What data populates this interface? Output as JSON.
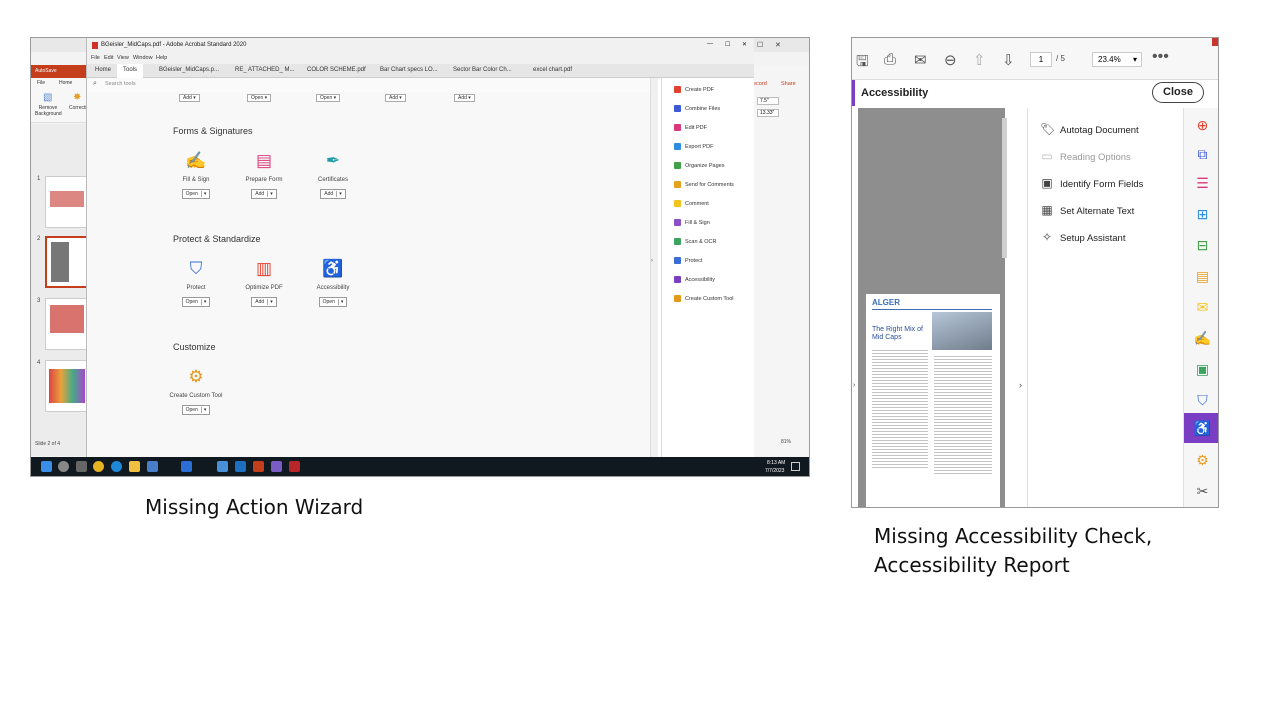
{
  "captions": {
    "left": "Missing Action Wizard",
    "right_line1": "Missing Accessibility Check,",
    "right_line2": "Accessibility Report"
  },
  "left_screenshot": {
    "acrobat": {
      "window_title": "BGeisler_MidCaps.pdf - Adobe Acrobat Standard 2020",
      "menu": [
        "File",
        "Edit",
        "View",
        "Window",
        "Help"
      ],
      "tabs": [
        "Home",
        "Tools",
        "BGeisler_MidCaps.p...",
        "RE_ ATTACHED_ M...",
        "COLOR SCHEME.pdf",
        "Bar Chart specs LO...",
        "Sector Bar Color Ch...",
        "excel chart.pdf"
      ],
      "active_tab": "Tools",
      "search_placeholder": "Search tools",
      "stub_buttons": [
        "Add",
        "Open",
        "Open",
        "Add",
        "Add"
      ],
      "sections": {
        "forms": {
          "title": "Forms & Signatures",
          "tools": [
            {
              "label": "Fill & Sign",
              "button": "Open",
              "icon": "fill-sign-icon"
            },
            {
              "label": "Prepare Form",
              "button": "Add",
              "icon": "prepare-form-icon"
            },
            {
              "label": "Certificates",
              "button": "Add",
              "icon": "certificates-icon"
            }
          ]
        },
        "protect": {
          "title": "Protect & Standardize",
          "tools": [
            {
              "label": "Protect",
              "button": "Open",
              "icon": "protect-icon"
            },
            {
              "label": "Optimize PDF",
              "button": "Add",
              "icon": "optimize-pdf-icon"
            },
            {
              "label": "Accessibility",
              "button": "Open",
              "icon": "accessibility-icon"
            }
          ]
        },
        "customize": {
          "title": "Customize",
          "tools": [
            {
              "label": "Create Custom Tool",
              "button": "Open",
              "icon": "custom-tool-icon"
            }
          ]
        }
      },
      "right_pane": [
        {
          "label": "Create PDF",
          "color": "#e2412f"
        },
        {
          "label": "Combine Files",
          "color": "#3d5bd9"
        },
        {
          "label": "Edit PDF",
          "color": "#d9397a"
        },
        {
          "label": "Export PDF",
          "color": "#2d8ee0"
        },
        {
          "label": "Organize Pages",
          "color": "#43a04a"
        },
        {
          "label": "Send for Comments",
          "color": "#e6a11e"
        },
        {
          "label": "Comment",
          "color": "#f2c21d"
        },
        {
          "label": "Fill & Sign",
          "color": "#8a4fc9"
        },
        {
          "label": "Scan & OCR",
          "color": "#3aa35e"
        },
        {
          "label": "Protect",
          "color": "#3a6ed6"
        },
        {
          "label": "Accessibility",
          "color": "#7a3ec4"
        },
        {
          "label": "Create Custom Tool",
          "color": "#e39a1b"
        }
      ]
    },
    "powerpoint": {
      "ribbon_tabs": [
        "File",
        "Home"
      ],
      "ribbon_buttons": [
        "Remove Background",
        "Corrections"
      ],
      "right_ribbon": [
        "ecord",
        "Share"
      ],
      "size_fields": [
        "7.5\"",
        "13.33\""
      ],
      "slide_numbers": [
        "1",
        "2",
        "3",
        "4"
      ],
      "status": "Slide 2 of 4",
      "zoom": "81%"
    },
    "taskbar": {
      "time": "8:13 AM",
      "date": "7/7/2023"
    }
  },
  "right_screenshot": {
    "page_current": "1",
    "page_total": "/ 5",
    "zoom": "23.4%",
    "panel_title": "Accessibility",
    "close_label": "Close",
    "tools": [
      {
        "label": "Autotag Document",
        "icon": "autotag-icon",
        "enabled": true
      },
      {
        "label": "Reading Options",
        "icon": "reading-options-icon",
        "enabled": false
      },
      {
        "label": "Identify Form Fields",
        "icon": "identify-form-fields-icon",
        "enabled": true
      },
      {
        "label": "Set Alternate Text",
        "icon": "alt-text-icon",
        "enabled": true
      },
      {
        "label": "Setup Assistant",
        "icon": "setup-assistant-icon",
        "enabled": true
      }
    ],
    "document": {
      "logo": "ALGER",
      "headline": "The Right Mix of Mid Caps"
    },
    "rail_colors": [
      "#e2412f",
      "#3d5bd9",
      "#d9397a",
      "#2d8ee0",
      "#43a04a",
      "#e6a11e",
      "#f2c21d",
      "#8a4fc9",
      "#3aa35e",
      "#3a6ed6",
      "#7a3ec4",
      "#e39a1b",
      "#555555"
    ]
  }
}
